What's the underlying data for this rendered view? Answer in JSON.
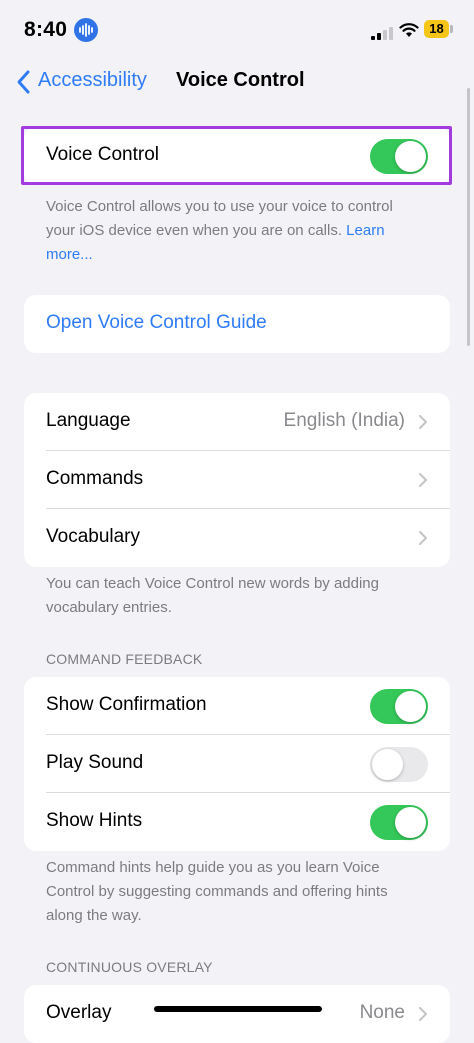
{
  "status_bar": {
    "time": "8:40",
    "battery": "18"
  },
  "nav": {
    "back_label": "Accessibility",
    "title": "Voice Control"
  },
  "voice_control_group": {
    "label": "Voice Control",
    "enabled": true,
    "footer_text": "Voice Control allows you to use your voice to control your iOS device even when you are on calls. ",
    "footer_link": "Learn more..."
  },
  "guide": {
    "label": "Open Voice Control Guide"
  },
  "settings_group": {
    "items": [
      {
        "label": "Language",
        "value": "English (India)"
      },
      {
        "label": "Commands",
        "value": ""
      },
      {
        "label": "Vocabulary",
        "value": ""
      }
    ],
    "footer_text": "You can teach Voice Control new words by adding vocabulary entries."
  },
  "command_feedback": {
    "header": "COMMAND FEEDBACK",
    "items": [
      {
        "label": "Show Confirmation",
        "enabled": true
      },
      {
        "label": "Play Sound",
        "enabled": false
      },
      {
        "label": "Show Hints",
        "enabled": true
      }
    ],
    "footer_text": "Command hints help guide you as you learn Voice Control by suggesting commands and offering hints along the way."
  },
  "continuous_overlay": {
    "header": "CONTINUOUS OVERLAY",
    "items": [
      {
        "label": "Overlay",
        "value": "None"
      }
    ]
  },
  "colors": {
    "accent": "#2f7cf6",
    "toggle_on": "#34c759",
    "highlight": "#a23be0",
    "background": "#f2f2f7"
  }
}
